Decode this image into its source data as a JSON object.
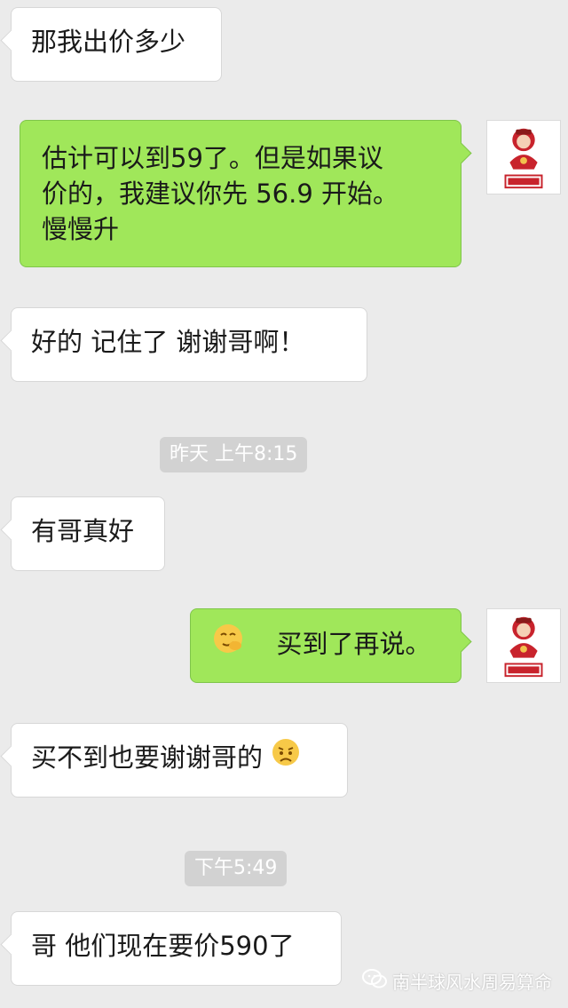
{
  "messages": [
    {
      "side": "left",
      "text": "那我出价多少"
    },
    {
      "side": "right",
      "lines": [
        "估计可以到59了。但是如果议",
        "价的，我建议你先 56.9 开始。",
        "慢慢升"
      ]
    },
    {
      "side": "left",
      "text": "好的 记住了  谢谢哥啊！"
    },
    {
      "side": "left",
      "text": "有哥真好"
    },
    {
      "side": "right",
      "text": "买到了再说。",
      "emoji": "smirk-hand-emoji"
    },
    {
      "side": "left",
      "text": "买不到也要谢谢哥的",
      "emoji": "worried-emoji"
    },
    {
      "side": "left",
      "text": "哥 他们现在要价590了"
    }
  ],
  "timestamps": [
    "昨天 上午8:15",
    "下午5:49"
  ],
  "avatar": {
    "brand_text": "旺运堂",
    "url_text": "WANGYUNTANG.COM.AU",
    "icon": "fortune-god-logo"
  },
  "watermark": {
    "text": "南半球风水周易算命",
    "icon": "wechat-icon"
  },
  "colors": {
    "background": "#ebebeb",
    "sent_bubble": "#a0e75a",
    "received_bubble": "#ffffff",
    "timestamp_bg": "#d2d2d2"
  }
}
